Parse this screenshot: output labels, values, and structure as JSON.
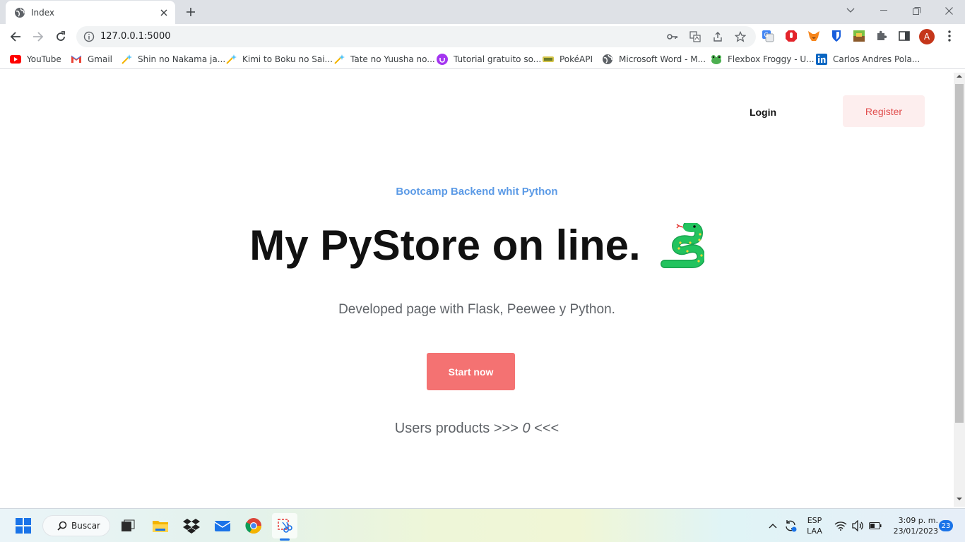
{
  "browser": {
    "tab": {
      "title": "Index"
    },
    "address": {
      "url": "127.0.0.1:5000"
    },
    "profile_initial": "A",
    "bookmarks": [
      {
        "label": "YouTube"
      },
      {
        "label": "Gmail"
      },
      {
        "label": "Shin no Nakama ja..."
      },
      {
        "label": "Kimi to Boku no Sai..."
      },
      {
        "label": "Tate no Yuusha no..."
      },
      {
        "label": "Tutorial gratuito so..."
      },
      {
        "label": "PokéAPI"
      },
      {
        "label": "Microsoft Word - M..."
      },
      {
        "label": "Flexbox Froggy - U..."
      },
      {
        "label": "Carlos Andres Pola..."
      }
    ]
  },
  "page": {
    "nav": {
      "login": "Login",
      "register": "Register"
    },
    "hero": {
      "eyebrow": "Bootcamp Backend whit Python",
      "title": "My PyStore on line.",
      "emoji": "snake-icon",
      "subtitle": "Developed page with Flask, Peewee y Python.",
      "cta": "Start now",
      "users_prefix": "Users products >>>",
      "users_count": "0",
      "users_suffix": "<<<"
    },
    "colors": {
      "accent": "#f47272",
      "eyebrow": "#5b9ae6",
      "register_bg": "#fdeeee"
    }
  },
  "taskbar": {
    "search_label": "Buscar",
    "lang_line1": "ESP",
    "lang_line2": "LAA",
    "time": "3:09 p. m.",
    "date": "23/01/2023",
    "notifications": "23"
  }
}
